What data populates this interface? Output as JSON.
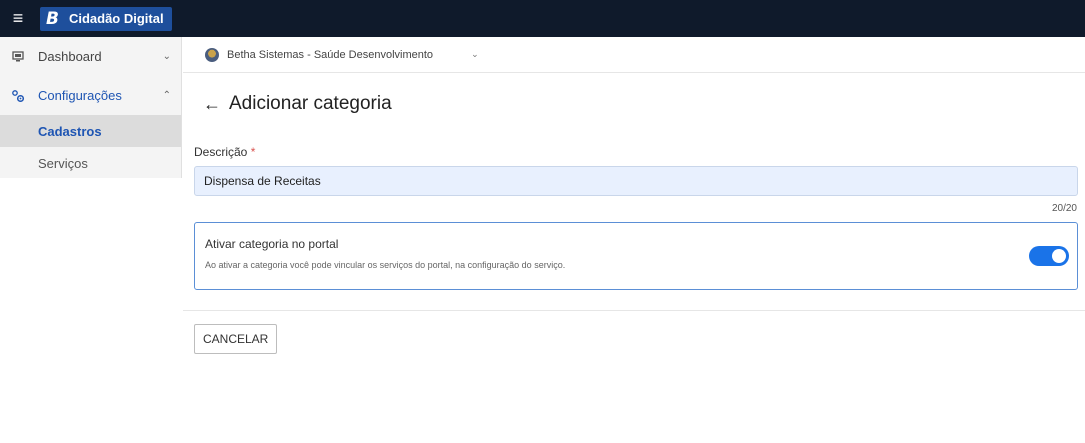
{
  "app": {
    "logo_letter": "B",
    "name": "Cidadão Digital"
  },
  "sidebar": {
    "items": [
      {
        "label": "Dashboard",
        "icon": "monitor-icon",
        "chevron": "chevron-down-icon"
      },
      {
        "label": "Configurações",
        "icon": "gears-icon",
        "chevron": "chevron-up-icon",
        "children": [
          {
            "label": "Cadastros",
            "selected": true
          },
          {
            "label": "Serviços",
            "selected": false
          }
        ]
      }
    ]
  },
  "org_selector": {
    "label": "Betha Sistemas - Saúde Desenvolvimento"
  },
  "page": {
    "title": "Adicionar categoria"
  },
  "form": {
    "description_label": "Descrição",
    "required_mark": "*",
    "description_value": "Dispensa de Receitas",
    "counter": "20/20",
    "toggle_card": {
      "title": "Ativar categoria no portal",
      "description": "Ao ativar a categoria você pode vincular os serviços do portal, na configuração do serviço.",
      "enabled": true
    },
    "cancel_label": "CANCELAR"
  },
  "colors": {
    "topbar": "#0f1a2b",
    "brand": "#1e4f9c",
    "accent": "#1a73e8",
    "active_text": "#1e55b3",
    "input_bg": "#e8f0fe"
  }
}
